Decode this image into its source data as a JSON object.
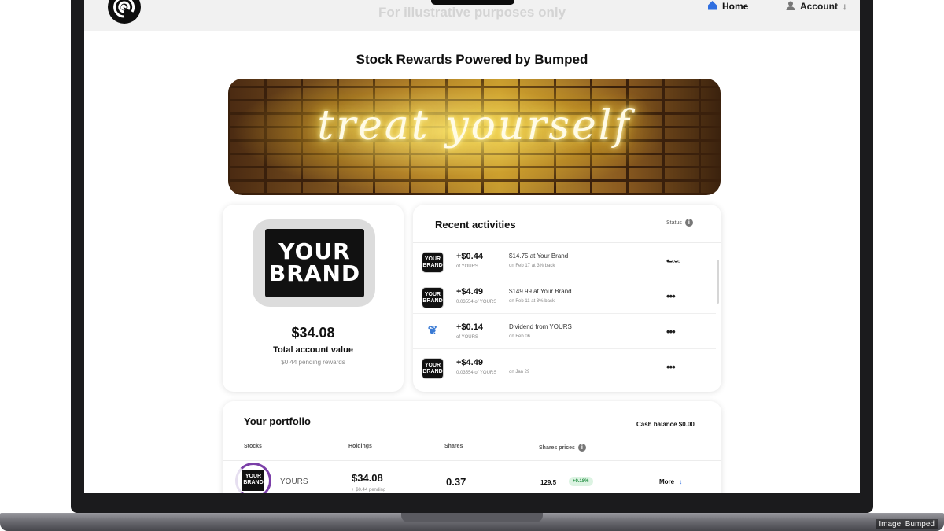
{
  "header": {
    "disclaimer": "For illustrative purposes only",
    "nav": {
      "home": "Home",
      "account": "Account"
    },
    "icons": [
      "spiral-logo-icon",
      "home-icon",
      "user-icon",
      "arrow-down-icon"
    ],
    "accent_color": "#2f6ee0"
  },
  "page": {
    "title": "Stock Rewards Powered by Bumped"
  },
  "banner": {
    "text": "treat yourself"
  },
  "account": {
    "brand_line1": "YOUR",
    "brand_line2": "BRAND",
    "total_value": "$34.08",
    "total_label": "Total account value",
    "pending": "$0.44 pending rewards"
  },
  "activities": {
    "title": "Recent activities",
    "status_label": "Status",
    "items": [
      {
        "amount": "+$0.44",
        "shares": "of YOURS",
        "desc": "$14.75 at Your Brand",
        "date": "on Feb 17 at 3% back",
        "status": "•-◦-◦",
        "icon": "brand-icon"
      },
      {
        "amount": "+$4.49",
        "shares": "0.03554 of YOURS",
        "desc": "$149.99 at Your Brand",
        "date": "on Feb 11 at 3% back",
        "status": "•••",
        "icon": "brand-icon"
      },
      {
        "amount": "+$0.14",
        "shares": "of YOURS",
        "desc": "Dividend from YOURS",
        "date": "on Feb 06",
        "status": "•••",
        "icon": "dividend-plant-icon"
      },
      {
        "amount": "+$4.49",
        "shares": "0.03554 of YOURS",
        "desc": "",
        "date": "on Jan 29",
        "status": "•••",
        "icon": "brand-icon"
      }
    ]
  },
  "portfolio": {
    "title": "Your portfolio",
    "cash_balance": "Cash balance $0.00",
    "columns": {
      "stocks": "Stocks",
      "holdings": "Holdings",
      "shares": "Shares",
      "prices": "Shares prices"
    },
    "row": {
      "symbol": "YOURS",
      "holding": "$34.08",
      "holding_sub": "+ $0.44 pending",
      "shares": "0.37",
      "price": "129.5",
      "change": "+0.18%",
      "more": "More"
    },
    "change_color": "#1c8a3c"
  },
  "credit": "Image: Bumped"
}
